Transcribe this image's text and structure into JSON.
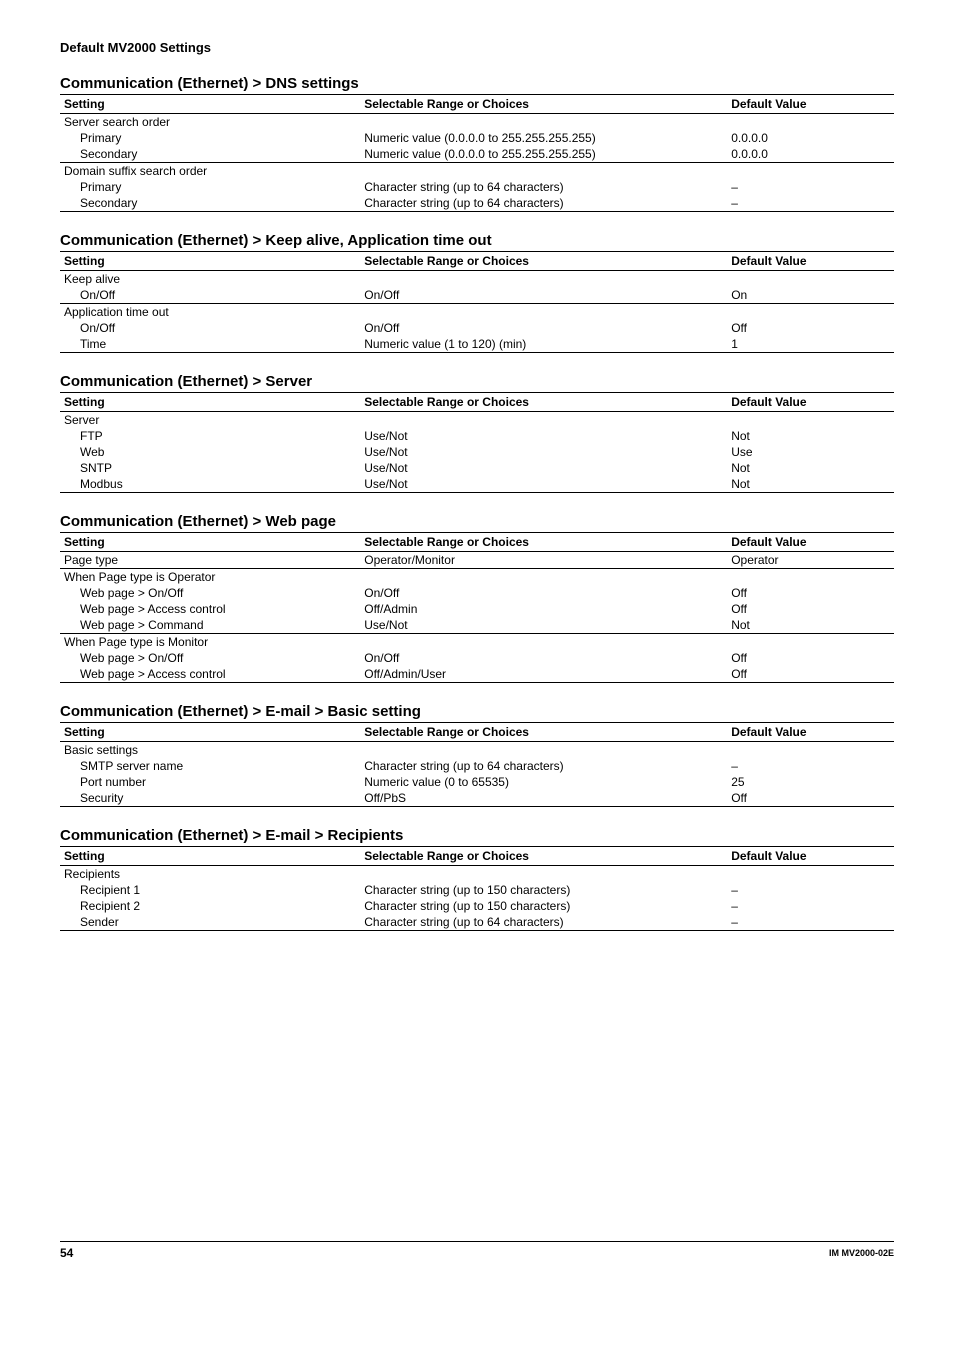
{
  "doc_header": "Default MV2000 Settings",
  "columns": {
    "setting": "Setting",
    "choices": "Selectable Range or Choices",
    "default": "Default Value"
  },
  "sections": [
    {
      "title": "Communication (Ethernet) > DNS settings",
      "rows": [
        {
          "setting": "Server search order",
          "choices": "",
          "default": "",
          "indent": 0,
          "group_start": false
        },
        {
          "setting": "Primary",
          "choices": "Numeric value (0.0.0.0 to 255.255.255.255)",
          "default": "0.0.0.0",
          "indent": 1
        },
        {
          "setting": "Secondary",
          "choices": "Numeric value (0.0.0.0 to 255.255.255.255)",
          "default": "0.0.0.0",
          "indent": 1
        },
        {
          "setting": "Domain suffix search order",
          "choices": "",
          "default": "",
          "indent": 0,
          "group_start": true
        },
        {
          "setting": "Primary",
          "choices": "Character string (up to 64 characters)",
          "default": "–",
          "indent": 1
        },
        {
          "setting": "Secondary",
          "choices": "Character string (up to 64 characters)",
          "default": "–",
          "indent": 1,
          "last": true
        }
      ]
    },
    {
      "title": "Communication (Ethernet) > Keep alive, Application time out",
      "rows": [
        {
          "setting": "Keep alive",
          "choices": "",
          "default": "",
          "indent": 0
        },
        {
          "setting": "On/Off",
          "choices": "On/Off",
          "default": "On",
          "indent": 1
        },
        {
          "setting": "Application time out",
          "choices": "",
          "default": "",
          "indent": 0,
          "group_start": true
        },
        {
          "setting": "On/Off",
          "choices": "On/Off",
          "default": "Off",
          "indent": 1
        },
        {
          "setting": "Time",
          "choices": "Numeric value (1 to 120) (min)",
          "default": "1",
          "indent": 1,
          "last": true
        }
      ]
    },
    {
      "title": "Communication (Ethernet) > Server",
      "rows": [
        {
          "setting": "Server",
          "choices": "",
          "default": "",
          "indent": 0
        },
        {
          "setting": "FTP",
          "choices": "Use/Not",
          "default": "Not",
          "indent": 1
        },
        {
          "setting": "Web",
          "choices": "Use/Not",
          "default": "Use",
          "indent": 1
        },
        {
          "setting": "SNTP",
          "choices": "Use/Not",
          "default": "Not",
          "indent": 1
        },
        {
          "setting": "Modbus",
          "choices": "Use/Not",
          "default": "Not",
          "indent": 1,
          "last": true
        }
      ]
    },
    {
      "title": "Communication (Ethernet) > Web page",
      "rows": [
        {
          "setting": "Page type",
          "choices": "Operator/Monitor",
          "default": "Operator",
          "indent": 0
        },
        {
          "setting": "When Page type is Operator",
          "choices": "",
          "default": "",
          "indent": 0,
          "group_start": true
        },
        {
          "setting": "Web page > On/Off",
          "choices": "On/Off",
          "default": "Off",
          "indent": 1
        },
        {
          "setting": "Web page > Access control",
          "choices": "Off/Admin",
          "default": "Off",
          "indent": 1
        },
        {
          "setting": "Web page > Command",
          "choices": "Use/Not",
          "default": "Not",
          "indent": 1
        },
        {
          "setting": "When Page type is Monitor",
          "choices": "",
          "default": "",
          "indent": 0,
          "group_start": true
        },
        {
          "setting": "Web page > On/Off",
          "choices": "On/Off",
          "default": "Off",
          "indent": 1
        },
        {
          "setting": "Web page > Access control",
          "choices": "Off/Admin/User",
          "default": "Off",
          "indent": 1,
          "last": true
        }
      ]
    },
    {
      "title": "Communication (Ethernet) > E-mail > Basic setting",
      "rows": [
        {
          "setting": "Basic settings",
          "choices": "",
          "default": "",
          "indent": 0
        },
        {
          "setting": "SMTP server name",
          "choices": "Character string (up to 64 characters)",
          "default": "–",
          "indent": 1
        },
        {
          "setting": "Port number",
          "choices": "Numeric value (0 to 65535)",
          "default": "25",
          "indent": 1
        },
        {
          "setting": "Security",
          "choices": "Off/PbS",
          "default": "Off",
          "indent": 1,
          "last": true
        }
      ]
    },
    {
      "title": "Communication (Ethernet) > E-mail > Recipients",
      "rows": [
        {
          "setting": "Recipients",
          "choices": "",
          "default": "",
          "indent": 0
        },
        {
          "setting": "Recipient 1",
          "choices": "Character string (up to 150 characters)",
          "default": "–",
          "indent": 1
        },
        {
          "setting": "Recipient 2",
          "choices": "Character string (up to 150 characters)",
          "default": "–",
          "indent": 1
        },
        {
          "setting": "Sender",
          "choices": "Character string (up to 64 characters)",
          "default": "–",
          "indent": 1,
          "last": true
        }
      ]
    }
  ],
  "footer": {
    "page_number": "54",
    "doc_id": "IM MV2000-02E"
  }
}
